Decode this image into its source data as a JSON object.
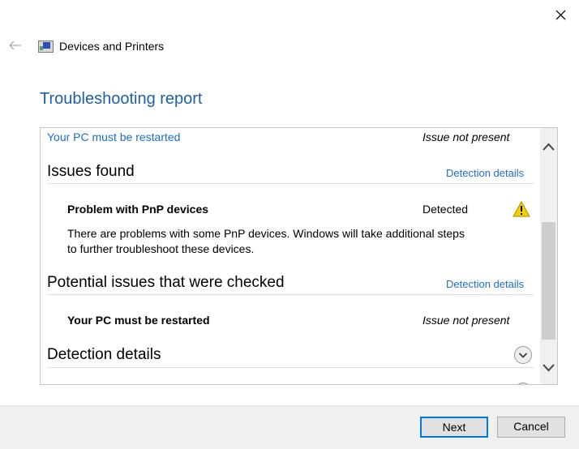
{
  "window": {
    "title": "Devices and Printers",
    "close_icon": "close-icon",
    "back_icon": "back-arrow-icon"
  },
  "page": {
    "title": "Troubleshooting report"
  },
  "report": {
    "top_row": {
      "label": "Your PC must be restarted",
      "status": "Issue not present"
    },
    "issues_found": {
      "heading": "Issues found",
      "link": "Detection details",
      "items": [
        {
          "title": "Problem with PnP devices",
          "status": "Detected",
          "icon": "warning-icon",
          "description_line1": "There are problems with some PnP devices. Windows will take additional steps",
          "description_line2": "to further troubleshoot these devices."
        }
      ]
    },
    "potential_issues": {
      "heading": "Potential issues that were checked",
      "link": "Detection details",
      "items": [
        {
          "title": "Your PC must be restarted",
          "status": "Issue not present"
        }
      ]
    },
    "detection_details": {
      "heading": "Detection details",
      "icon": "expand-chevron-icon"
    }
  },
  "footer": {
    "next_label": "Next",
    "cancel_label": "Cancel"
  }
}
